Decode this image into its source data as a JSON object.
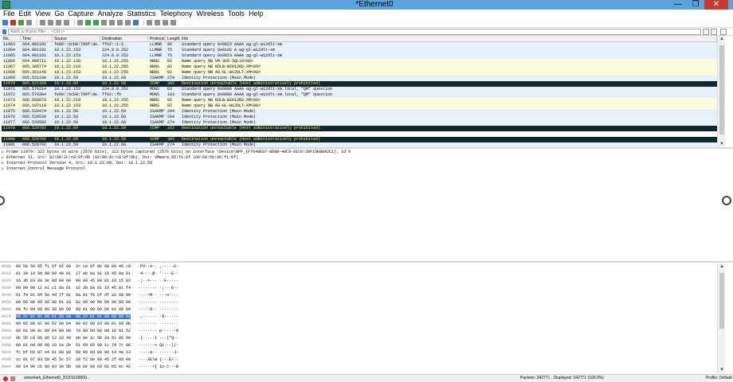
{
  "window": {
    "title": "*Ethernet0",
    "minimize": "—",
    "restore": "❐",
    "close": "✕"
  },
  "menu": [
    "File",
    "Edit",
    "View",
    "Go",
    "Capture",
    "Analyze",
    "Statistics",
    "Telephony",
    "Wireless",
    "Tools",
    "Help"
  ],
  "filter": {
    "placeholder": "Apply a display filter ... <Ctrl-/>"
  },
  "columns": [
    "No.",
    "Time",
    "Source",
    "Destination",
    "Protocol",
    "Length",
    "Info"
  ],
  "packets": [
    {
      "no": "11963",
      "time": "664.981101",
      "src": "fe80::6cb8:799f:de...",
      "dst": "ff02::1:3",
      "proto": "LLMNR",
      "len": "95",
      "info": "Standard query 0x0023 AAAA ag-gl-w12dlt-xm",
      "style": "blue"
    },
    {
      "no": "11964",
      "time": "664.981101",
      "src": "10.1.22.153",
      "dst": "224.0.0.252",
      "proto": "LLMNR",
      "len": "75",
      "info": "Standard query 0x01d2 A ag-gl-w12dlt-xm",
      "style": "blue"
    },
    {
      "no": "11965",
      "time": "664.981101",
      "src": "10.1.22.153",
      "dst": "224.0.0.252",
      "proto": "LLMNR",
      "len": "75",
      "info": "Standard query 0x0023 AAAA ag-gl-w12dlt-xm",
      "style": "blue"
    },
    {
      "no": "11966",
      "time": "664.989711",
      "src": "10.1.22.138",
      "dst": "10.1.22.255",
      "proto": "NBNS",
      "len": "92",
      "info": "Name query NB VM-3U5-SQL16<00>",
      "style": "yellow"
    },
    {
      "no": "11967",
      "time": "665.305774",
      "src": "10.1.22.218",
      "dst": "10.1.22.255",
      "proto": "NBNS",
      "len": "92",
      "info": "Name query NB KDLB-W2012R2-XM<00>",
      "style": "yellow"
    },
    {
      "no": "11968",
      "time": "665.351149",
      "src": "10.1.22.153",
      "dst": "10.1.22.255",
      "proto": "NBNS",
      "len": "92",
      "info": "Name query NB AG-GL-W12DLT-XM<00>",
      "style": "yellow"
    },
    {
      "no": "11969",
      "time": "665.521198",
      "src": "10.1.22.59",
      "dst": "10.1.22.69",
      "proto": "ISAKMP",
      "len": "274",
      "info": "Identity Protection (Main Mode)",
      "style": "blue"
    },
    {
      "no": "11970",
      "time": "665.521399",
      "src": "10.1.22.69",
      "dst": "10.1.22.59",
      "proto": "ICMP",
      "len": "302",
      "info": "Destination unreachable (Host administratively prohibited)",
      "style": "icmp"
    },
    {
      "no": "11971",
      "time": "665.570214",
      "src": "10.1.22.153",
      "dst": "224.0.0.251",
      "proto": "MDNS",
      "len": "83",
      "info": "Standard query 0x0000 AAAA ag-gl-w12dlt-xm.local, \"QM\" question",
      "style": "blue"
    },
    {
      "no": "11972",
      "time": "665.570304",
      "src": "fe80::6cb8:799f:de...",
      "dst": "ff02::fb",
      "proto": "MDNS",
      "len": "103",
      "info": "Standard query 0x0000 AAAA ag-gl-w12dlt-xm.local, \"QM\" question",
      "style": "blue"
    },
    {
      "no": "11973",
      "time": "666.058879",
      "src": "10.1.22.218",
      "dst": "10.1.22.255",
      "proto": "NBNS",
      "len": "92",
      "info": "Name query NB KDLB-W2012R2-XM<00>",
      "style": "yellow"
    },
    {
      "no": "11974",
      "time": "666.107110",
      "src": "10.1.22.153",
      "dst": "10.1.22.255",
      "proto": "NBNS",
      "len": "92",
      "info": "Name query NB AG-GL-W12DLT-XM<00>",
      "style": "yellow"
    },
    {
      "no": "11975",
      "time": "666.520474",
      "src": "10.1.22.59",
      "dst": "10.1.22.69",
      "proto": "ISAKMP",
      "len": "294",
      "info": "Identity Protection (Main Mode)",
      "style": "blue"
    },
    {
      "no": "11976",
      "time": "666.520536",
      "src": "10.1.22.59",
      "dst": "10.1.22.69",
      "proto": "ISAKMP",
      "len": "294",
      "info": "Identity Protection (Main Mode)",
      "style": "blue"
    },
    {
      "no": "11977",
      "time": "666.520582",
      "src": "10.1.22.59",
      "dst": "10.1.22.69",
      "proto": "ISAKMP",
      "len": "274",
      "info": "Identity Protection (Main Mode)",
      "style": "blue"
    },
    {
      "no": "11978",
      "time": "666.520702",
      "src": "10.1.22.69",
      "dst": "10.1.22.59",
      "proto": "ICMP",
      "len": "322",
      "info": "Destination unreachable (Host administratively prohibited)",
      "style": "icmp"
    },
    {
      "no": "",
      "time": "",
      "src": "",
      "dst": "",
      "proto": "",
      "len": "",
      "info": "",
      "style": ""
    },
    {
      "no": "11980",
      "time": "666.520702",
      "src": "10.1.22.69",
      "dst": "10.1.22.59",
      "proto": "ICMP",
      "len": "302",
      "info": "Destination unreachable (Host administratively prohibited)",
      "style": "icmp"
    },
    {
      "no": "11981",
      "time": "666.520702",
      "src": "10.1.22.59",
      "dst": "10.1.22.69",
      "proto": "ISAKMP",
      "len": "274",
      "info": "Identity Protection (Main Mode)",
      "style": "blue"
    }
  ],
  "details": [
    "Frame 11979: 322 bytes on wire (2576 bits), 322 bytes captured (2576 bits) on interface \\Device\\NPF_{F7648E07-8D8B-48C8-81C6-28F15EB8A2C1}, id 0",
    "Ethernet II, Src: 02:00:2c:c0:0f:0b (02:00:2c:c0:0f:0b), Dst: VMware_95:f1:6f (00:50:56:95:f1:6f)",
    "Internet Protocol Version 4, Src: 10.1.22.69, Dst: 10.1.22.59",
    "Internet Control Message Protocol"
  ],
  "hex": [
    {
      "off": "0000",
      "bytes": "00 50 56 95 f1 6f 02 00  2c c0 0f 0b 08 00 45 c0",
      "ascii": "·PV··o·· ,·····E·"
    },
    {
      "off": "0010",
      "bytes": "01 34 10 9d 00 00 40 01  27 eb 0a 01 16 45 0a 01",
      "ascii": "·4····@· '····E··"
    },
    {
      "off": "0020",
      "bytes": "16 3b 03 0a 3e 8d 00 00  00 00 45 00 01 18 15 92",
      "ascii": "·;··>··· ··E·····"
    },
    {
      "off": "0030",
      "bytes": "00 00 80 11 e1 c1 0a 01  16 3b 0a 01 16 45 01 f4",
      "ascii": "········ ·;···E··"
    },
    {
      "off": "0040",
      "bytes": "01 f4 01 04 5e 4d 7f 91  0a 01 f6 6f df a1 00 00",
      "ascii": "····^M·· ···o····"
    },
    {
      "off": "0050",
      "bytes": "00 00 00 00 00 00 01 10  02 00 00 00 00 00 00 00",
      "ascii": "········ ········"
    },
    {
      "off": "0060",
      "bytes": "00 fc 0d 00 00 38 00 00  00 01 00 00 00 01 00 00",
      "ascii": "·····8·· ········"
    },
    {
      "off": "0070",
      "bytes": "00 2c 01 01 00 01 00 00  00 24 01 01 00 00 80 01",
      "ascii": "·,······ ·$······"
    },
    {
      "off": "0080",
      "bytes": "00 05 80 02 00 02 80 04  00 02 80 03 00 01 80 0b",
      "ascii": "········ ········"
    },
    {
      "off": "0090",
      "bytes": "00 01 00 0c 00 04 00 00  70 80 0d 00 00 18 01 52",
      "ascii": "········ p······R"
    },
    {
      "off": "00a0",
      "bytes": "8b 5b c8 06 96 12 18 49  eb 9e 1c 5b 2a 51 00 00",
      "ascii": "·[·····I ···[*Q··"
    },
    {
      "off": "00b0",
      "bytes": "00 01 0d 00 00 18 1e 2b  51 69 05 99 1c 7d 7c 96",
      "ascii": "·······+ Qi···}|·"
    },
    {
      "off": "00c0",
      "bytes": "fc bf b5 87 e4 61 00 00  00 09 0d 00 00 14 4a 13",
      "ascii": "·····a·· ······J·"
    },
    {
      "off": "00d0",
      "bytes": "1c 81 07 03 58 45 5c 57  28 f2 0e 99 45 2f 0d 00",
      "ascii": "····XE\\W (···E/··"
    },
    {
      "off": "00e0",
      "bytes": "00 14 90 cb 80 93 3e 5b  69 6e 08 63 81 b5 ec 42",
      "ascii": "······>[ in·c···B"
    }
  ],
  "status": {
    "file": "wireshark_Ethernet0_20201109000...",
    "packets": "Packets: 342771 · Displayed: 342771 (100.0%)",
    "profile": "Profile: Default"
  }
}
